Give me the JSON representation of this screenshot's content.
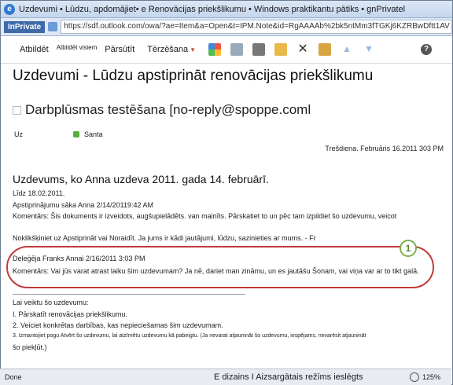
{
  "window": {
    "title": "Uzdevumi • Lūdzu, apdomājiet• e Renovācijas priekšlikumu • Windows praktikantu pātiks • gnPrivatel"
  },
  "addressbar": {
    "inprivate": "InPrivate",
    "url": "https://sdf.outlook.com/owa/?ae=Item&a=Open&t=IPM.Note&id=RgAAAAb%2bk5ntMm3fTGKj6KZRBwDftt1AV"
  },
  "toolbar": {
    "reply": "Atbildēt",
    "reply_all": "Atbildēt visiem",
    "forward": "Pārsūtīt",
    "chat": "Tērzēšana"
  },
  "message": {
    "subject": "Uzdevumi - Lūdzu apstiprināt renovācijas priekšlikumu",
    "sender": "Darbplūsmas testēšana [no-reply@spoppe.coml",
    "to_label": "Uz",
    "to_name": "Santa",
    "date": "Trešdiena. Februāris 16.2011 303 PM",
    "body_title": "Uzdevums, ko Anna uzdeva 2011. gada 14. februārī.",
    "due": "Līdz 18.02.2011.",
    "approval_started": "Apstiprinājumu sāka Anna 2/14/20119:42 AM",
    "comment1": "Komentārs: Šis dokuments ir izveidots, augšupielādēts. van mainīts. Pārskatiet to un pēc tam izpildiet šo uzdevumu, veicot",
    "instruction": "Noklikšķiniet uz Apstiprināt vai Noraidīt. Ja jums ir kādi jautājumi, lūdzu, sazinieties ar mums. - Fr",
    "delegated": "Deleģēja Franks Annai 2/16/2011 3:03 PM",
    "comment2": "Komentārs: Vai jūs varat atrast laiku šim uzdevumam? Ja nē, dariet man zināmu, un es jautāšu Šonam, vai viņa var ar to tikt galā.",
    "callout": "1",
    "steps_title": "Lai veiktu šo uzdevumu:",
    "step1": "I. Pārskatīt renovācijas priekšlikumu.",
    "step2": "2. Veiciet konkrētas darbības, kas nepieciešamas šim uzdevumam.",
    "step3": "3. Izmantojiet pogu Atvērt šo uzdevumu, lai atzīmētu uzdevumu kā pabeigtu. (Ja nevarat atjaunināt šo uzdevumu, iespējams, nevarēsit atjaunināt",
    "step3b": "šo piekļūt.)"
  },
  "statusbar": {
    "done": "Done",
    "zone": "E dizains I Aizsargātais režīms ieslēgts",
    "zoom": "125%"
  },
  "colors": {
    "oval": "#c23a3a",
    "callout": "#7ab24a",
    "inprivate": "#3f6aa8"
  }
}
